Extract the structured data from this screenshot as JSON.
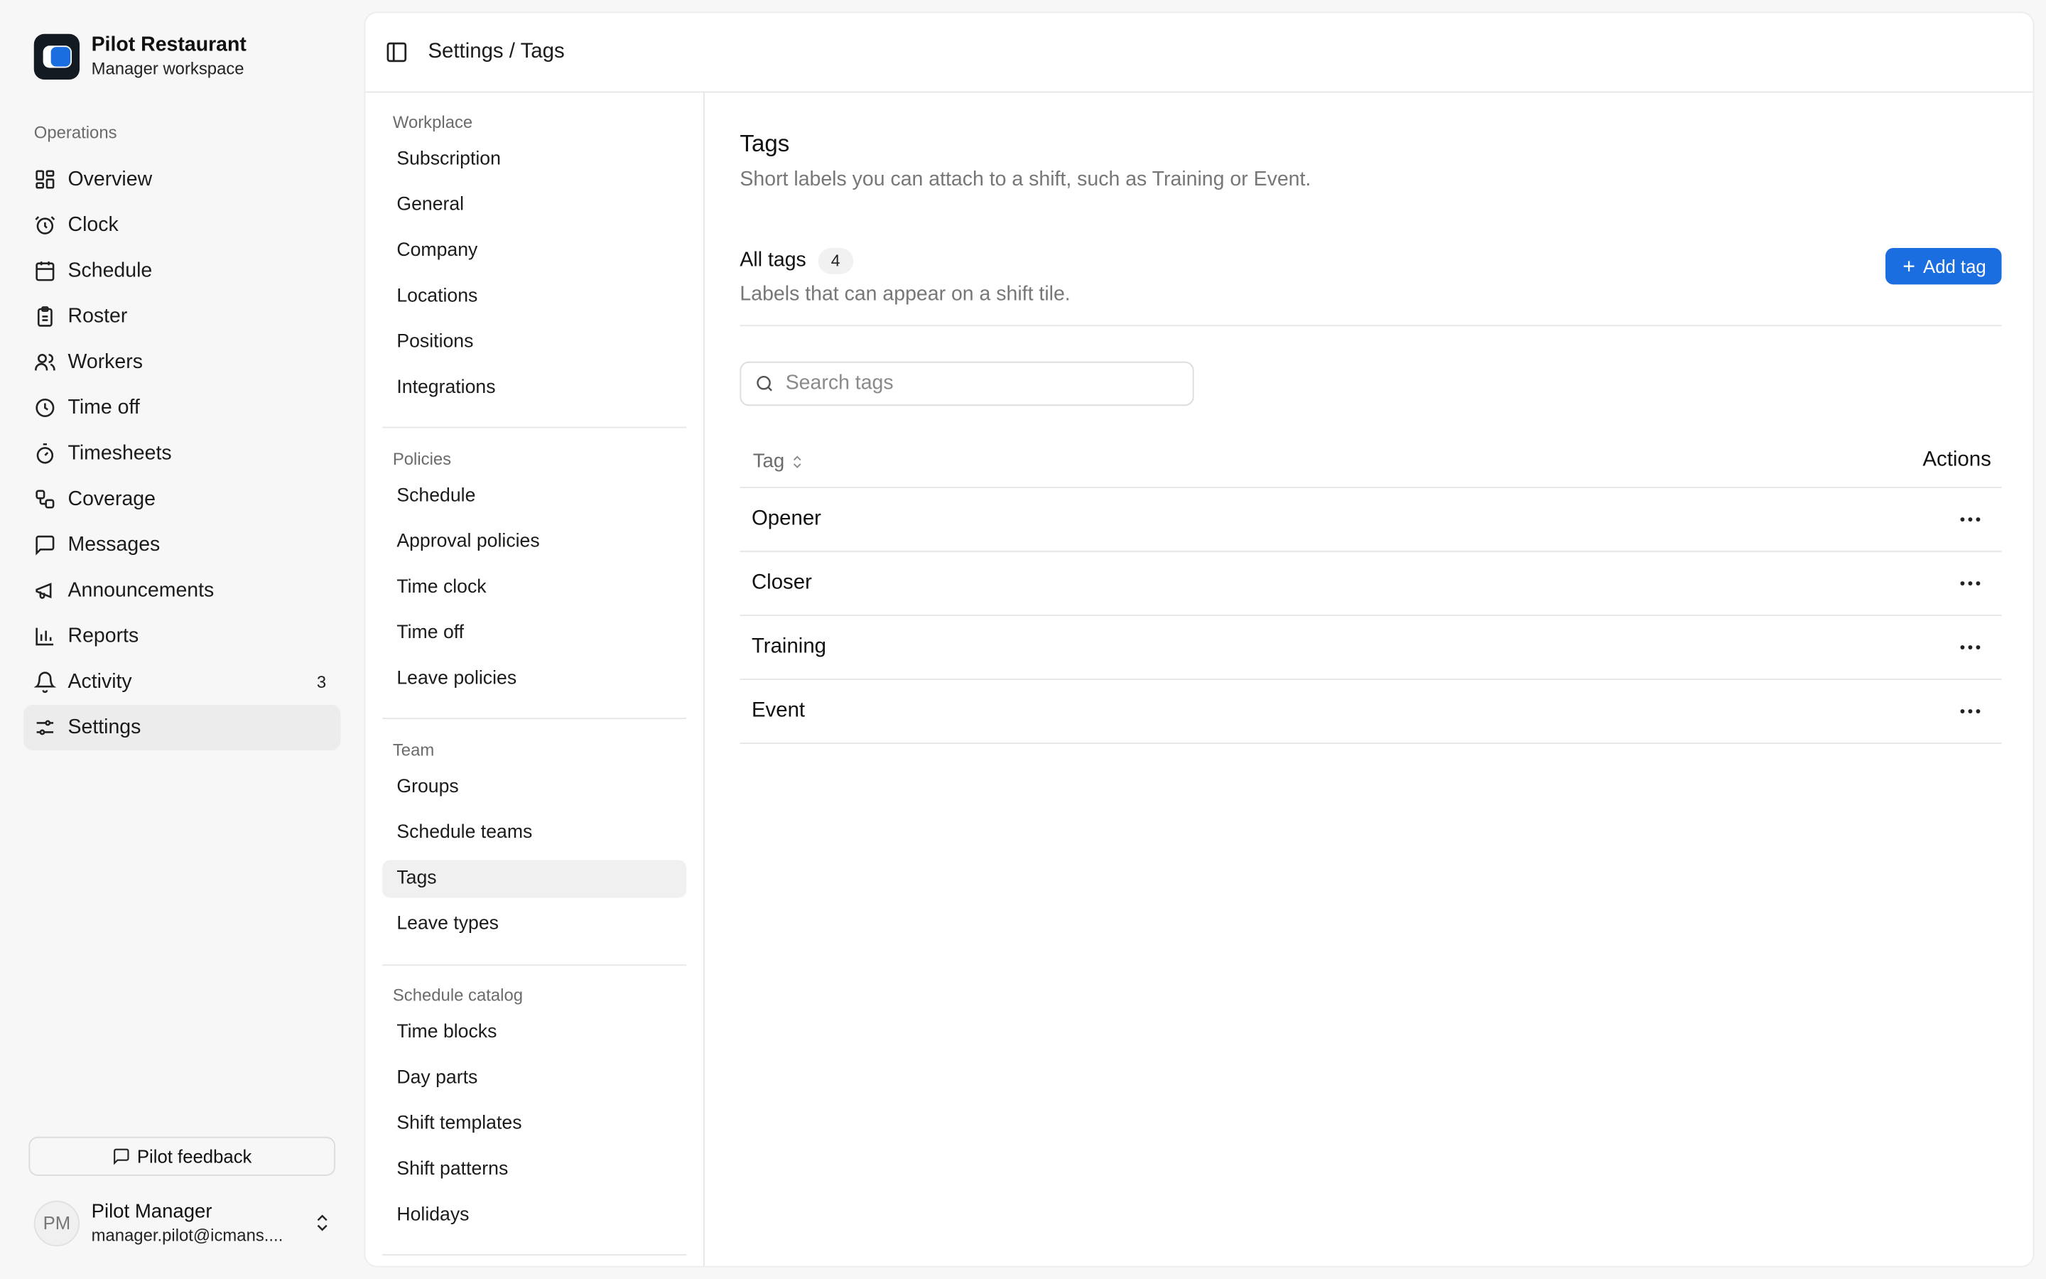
{
  "brand": {
    "name": "Pilot Restaurant",
    "subtitle": "Manager workspace"
  },
  "sidebar": {
    "section_label": "Operations",
    "items": [
      {
        "label": "Overview",
        "icon": "grid-icon"
      },
      {
        "label": "Clock",
        "icon": "alarm-clock-icon"
      },
      {
        "label": "Schedule",
        "icon": "calendar-icon"
      },
      {
        "label": "Roster",
        "icon": "clipboard-icon"
      },
      {
        "label": "Workers",
        "icon": "users-icon"
      },
      {
        "label": "Time off",
        "icon": "clock-icon"
      },
      {
        "label": "Timesheets",
        "icon": "stopwatch-icon"
      },
      {
        "label": "Coverage",
        "icon": "workflow-icon"
      },
      {
        "label": "Messages",
        "icon": "message-icon"
      },
      {
        "label": "Announcements",
        "icon": "megaphone-icon"
      },
      {
        "label": "Reports",
        "icon": "bar-chart-icon"
      },
      {
        "label": "Activity",
        "icon": "bell-icon",
        "badge": "3"
      },
      {
        "label": "Settings",
        "icon": "sliders-icon",
        "active": true
      }
    ],
    "feedback_label": "Pilot feedback"
  },
  "user": {
    "initials": "PM",
    "name": "Pilot Manager",
    "email": "manager.pilot@icmans...."
  },
  "topbar": {
    "breadcrumb": "Settings / Tags"
  },
  "subnav": {
    "groups": [
      {
        "label": "Workplace",
        "items": [
          "Subscription",
          "General",
          "Company",
          "Locations",
          "Positions",
          "Integrations"
        ]
      },
      {
        "label": "Policies",
        "items": [
          "Schedule",
          "Approval policies",
          "Time clock",
          "Time off",
          "Leave policies"
        ]
      },
      {
        "label": "Team",
        "items": [
          "Groups",
          "Schedule teams",
          "Tags",
          "Leave types"
        ],
        "active": "Tags"
      },
      {
        "label": "Schedule catalog",
        "items": [
          "Time blocks",
          "Day parts",
          "Shift templates",
          "Shift patterns",
          "Holidays"
        ]
      }
    ]
  },
  "page": {
    "title": "Tags",
    "description": "Short labels you can attach to a shift, such as Training or Event.",
    "section_title": "All tags",
    "count": "4",
    "section_description": "Labels that can appear on a shift tile.",
    "add_button": "Add tag",
    "search_placeholder": "Search tags",
    "table": {
      "col_tag": "Tag",
      "col_actions": "Actions",
      "rows": [
        "Opener",
        "Closer",
        "Training",
        "Event"
      ]
    }
  },
  "colors": {
    "accent": "#1a6ee0",
    "brand_dark": "#141a22"
  }
}
